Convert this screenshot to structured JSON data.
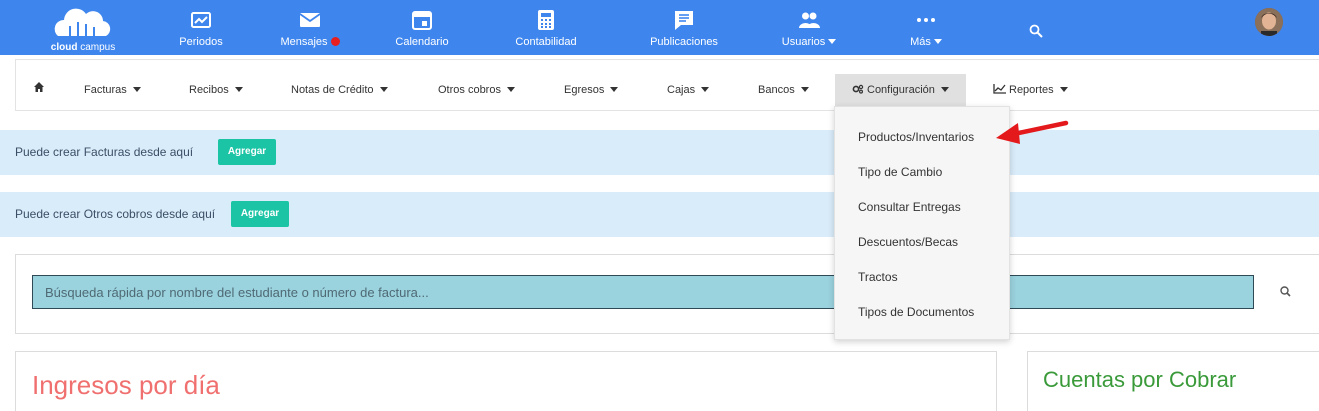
{
  "brand": {
    "name_bold": "cloud",
    "name_rest": " campus"
  },
  "topnav": {
    "items": [
      {
        "label": "Periodos",
        "icon": "trending-up-icon"
      },
      {
        "label": "Mensajes",
        "icon": "mail-icon",
        "badge_color": "#e91e1e"
      },
      {
        "label": "Calendario",
        "icon": "calendar-icon"
      },
      {
        "label": "Contabilidad",
        "icon": "calculator-icon"
      },
      {
        "label": "Publicaciones",
        "icon": "announcement-icon"
      },
      {
        "label": "Usuarios",
        "icon": "people-icon"
      },
      {
        "label": "Más",
        "icon": "more-horizontal-icon"
      }
    ],
    "search_icon": "search-icon",
    "accent_color": "#3e86ee"
  },
  "submenu": {
    "home_icon": "home-icon",
    "items": [
      "Facturas",
      "Recibos",
      "Notas de Crédito",
      "Otros cobros",
      "Egresos",
      "Cajas",
      "Bancos",
      "Configuración",
      "Reportes"
    ],
    "active": "Configuración"
  },
  "config_menu": {
    "items": [
      "Productos/Inventarios",
      "Tipo de Cambio",
      "Consultar Entregas",
      "Descuentos/Becas",
      "Tractos",
      "Tipos de Documentos"
    ]
  },
  "alerts": {
    "facturas": {
      "text": "Puede crear Facturas desde aquí",
      "button": "Agregar"
    },
    "otros": {
      "text": "Puede crear Otros cobros desde aquí",
      "button": "Agregar"
    }
  },
  "search": {
    "placeholder": "Búsqueda rápida por nombre del estudiante o número de factura..."
  },
  "panels": {
    "ingresos_title": "Ingresos por día",
    "cuentas_title": "Cuentas por Cobrar"
  },
  "colors": {
    "add_button": "#1cc4a6",
    "alert_bg": "#d9ecfa",
    "ingresos_title": "#f07070",
    "cuentas_title": "#3a9a3a",
    "arrow": "#e3191b"
  }
}
